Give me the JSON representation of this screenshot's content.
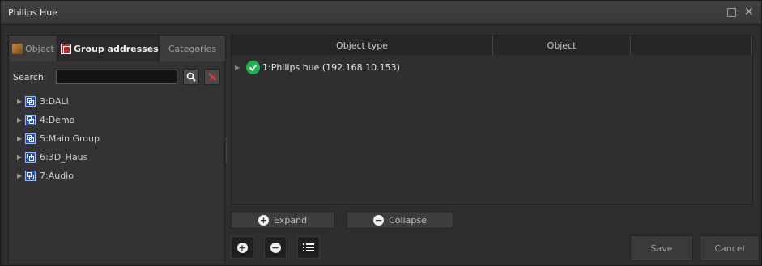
{
  "window": {
    "title": "Philips Hue",
    "maximize_icon": "□",
    "close_icon": "✕"
  },
  "tabs": [
    {
      "label": "Object",
      "icon": "object-icon"
    },
    {
      "label": "Group addresses",
      "icon": "group-address-icon"
    },
    {
      "label": "Categories",
      "icon": ""
    }
  ],
  "search": {
    "label": "Search:",
    "value": "",
    "placeholder": ""
  },
  "tree": [
    {
      "label": "3:DALI"
    },
    {
      "label": "4:Demo"
    },
    {
      "label": "5:Main Group"
    },
    {
      "label": "6:3D_Haus"
    },
    {
      "label": "7:Audio"
    }
  ],
  "grid": {
    "columns": [
      "Object type",
      "Object"
    ],
    "rows": [
      {
        "label": "1:Philips hue (192.168.10.153)",
        "status": "ok"
      }
    ]
  },
  "actions": {
    "expand": "Expand",
    "collapse": "Collapse"
  },
  "footer": {
    "save": "Save",
    "cancel": "Cancel"
  },
  "colors": {
    "accent_green": "#1eb24a",
    "clear_red": "#c0282b",
    "group_blue": "#2050c8"
  }
}
